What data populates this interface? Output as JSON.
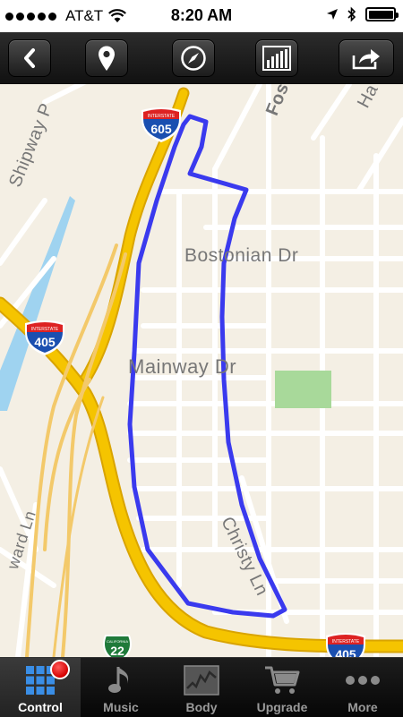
{
  "status_bar": {
    "carrier": "AT&T",
    "time": "8:20 AM",
    "signal_bars": 5,
    "signal_filled": 5,
    "battery_level": 1.0
  },
  "toolbar": {
    "buttons": [
      {
        "name": "back",
        "icon": "chevron-left-icon"
      },
      {
        "name": "location",
        "icon": "map-pin-icon"
      },
      {
        "name": "compass",
        "icon": "compass-icon"
      },
      {
        "name": "chart",
        "icon": "bar-chart-icon"
      },
      {
        "name": "share",
        "icon": "share-icon"
      }
    ]
  },
  "map": {
    "street_labels": {
      "bostonian": "Bostonian Dr",
      "mainway": "Mainway Dr",
      "christy": "Christy Ln",
      "shipway": "Shipway P",
      "foster": "Fos",
      "ha": "Ha",
      "ward": "ward Ln"
    },
    "shields": {
      "i605": "605",
      "i405_left": "405",
      "i405_bottom": "405",
      "ca22": "22"
    },
    "shield_label": "INTERSTATE",
    "state_label": "CALIFORNIA",
    "route_color": "#3a3aee",
    "freeway_color": "#f5c400",
    "park_color": "#a8d99a",
    "water_color": "#9fd3f0"
  },
  "tabs": [
    {
      "label": "Control",
      "icon": "grid-icon",
      "active": true,
      "recording": true
    },
    {
      "label": "Music",
      "icon": "music-note-icon",
      "active": false
    },
    {
      "label": "Body",
      "icon": "line-chart-icon",
      "active": false
    },
    {
      "label": "Upgrade",
      "icon": "cart-icon",
      "active": false
    },
    {
      "label": "More",
      "icon": "more-dots-icon",
      "active": false
    }
  ]
}
